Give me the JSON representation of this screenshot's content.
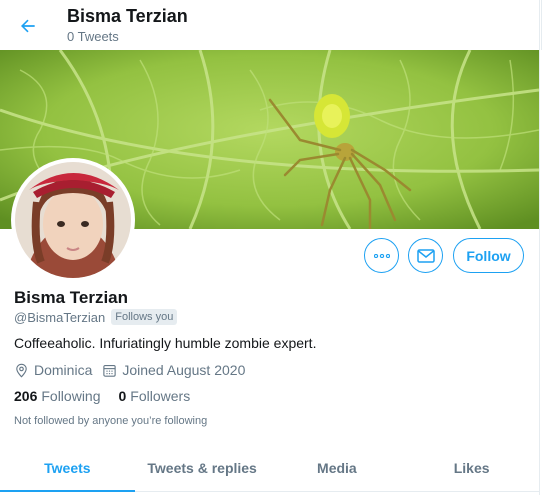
{
  "header": {
    "name": "Bisma Terzian",
    "tweet_count": "0 Tweets"
  },
  "profile": {
    "name": "Bisma Terzian",
    "handle": "@BismaTerzian",
    "follows_you": "Follows you",
    "bio": "Coffeeaholic. Infuriatingly humble zombie expert.",
    "location": "Dominica",
    "joined": "Joined August 2020",
    "following_count": "206",
    "following_label": "Following",
    "followers_count": "0",
    "followers_label": "Followers",
    "not_followed": "Not followed by anyone you’re following"
  },
  "actions": {
    "follow_label": "Follow",
    "more_icon": "more-icon",
    "message_icon": "envelope-icon"
  },
  "tabs": [
    {
      "label": "Tweets",
      "active": true
    },
    {
      "label": "Tweets & replies",
      "active": false
    },
    {
      "label": "Media",
      "active": false
    },
    {
      "label": "Likes",
      "active": false
    }
  ],
  "colors": {
    "accent": "#1da1f2",
    "muted": "#657786",
    "text": "#14171a"
  }
}
